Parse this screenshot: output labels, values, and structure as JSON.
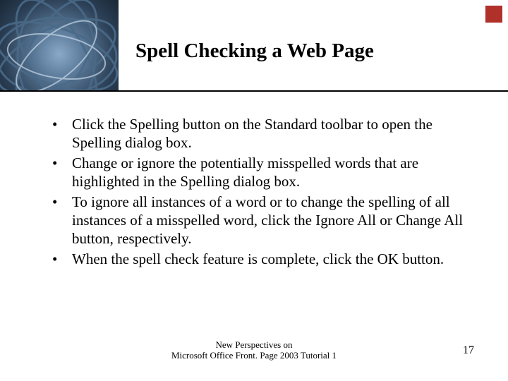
{
  "slide": {
    "title": "Spell Checking a Web Page",
    "bullets": [
      "Click the Spelling button on the Standard toolbar to open the Spelling dialog box.",
      "Change or ignore the potentially misspelled words that are highlighted in the Spelling dialog box.",
      "To ignore all instances of a word or to change the spelling of all instances of a misspelled word, click the Ignore All or Change All button, respectively.",
      "When the spell check feature is complete, click the OK button."
    ],
    "footer_line1": "New Perspectives on",
    "footer_line2": "Microsoft Office Front. Page 2003 Tutorial 1",
    "page_number": "17"
  }
}
